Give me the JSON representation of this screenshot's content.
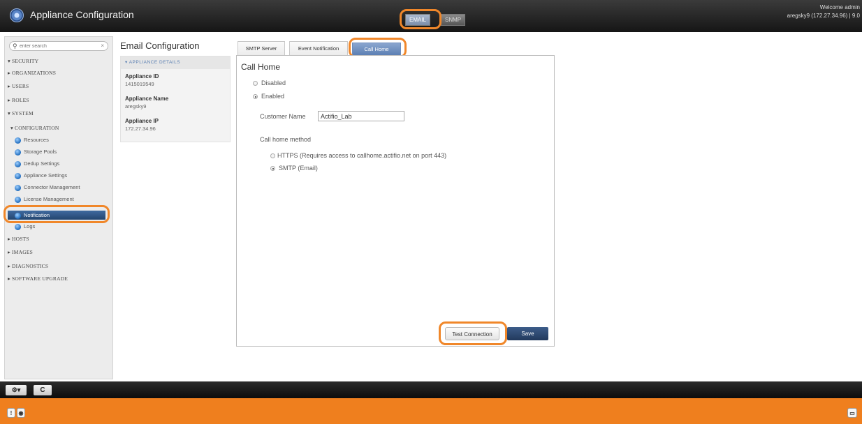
{
  "app": {
    "title": "Appliance Configuration",
    "tabs": [
      "EMAIL",
      "SNMP"
    ],
    "welcome": "Welcome admin",
    "host_info": "aregsky9 (172.27.34.96) | 9.0"
  },
  "search": {
    "placeholder": "enter search"
  },
  "nav": {
    "security": "SECURITY",
    "organizations": "ORGANIZATIONS",
    "users": "USERS",
    "roles": "ROLES",
    "system": "SYSTEM",
    "configuration": "CONFIGURATION",
    "items": [
      "Resources",
      "Storage Pools",
      "Dedup Settings",
      "Appliance Settings",
      "Connector Management",
      "License Management",
      "Notification",
      "Logs"
    ],
    "hosts": "HOSTS",
    "images": "IMAGES",
    "diagnostics": "DIAGNOSTICS",
    "software_upgrade": "SOFTWARE UPGRADE"
  },
  "mid": {
    "title": "Email Configuration",
    "section": "APPLIANCE DETAILS",
    "id_label": "Appliance ID",
    "id_value": "1415019549",
    "name_label": "Appliance Name",
    "name_value": "aregsky9",
    "ip_label": "Appliance IP",
    "ip_value": "172.27.34.96"
  },
  "content": {
    "tabs": [
      "SMTP Server",
      "Event Notification",
      "Call Home"
    ],
    "title": "Call Home",
    "disabled": "Disabled",
    "enabled": "Enabled",
    "customer_label": "Customer Name",
    "customer_value": "Actifio_Lab",
    "method_label": "Call home method",
    "https": "HTTPS (Requires access to callhome.actifio.net on port 443)",
    "smtp": "SMTP (Email)",
    "test": "Test Connection",
    "save": "Save"
  },
  "bottom": {
    "refresh": "C"
  },
  "colors": {
    "accent": "#ef7f1e",
    "nav_active": "#2f5485",
    "highlight": "#f0872a"
  }
}
